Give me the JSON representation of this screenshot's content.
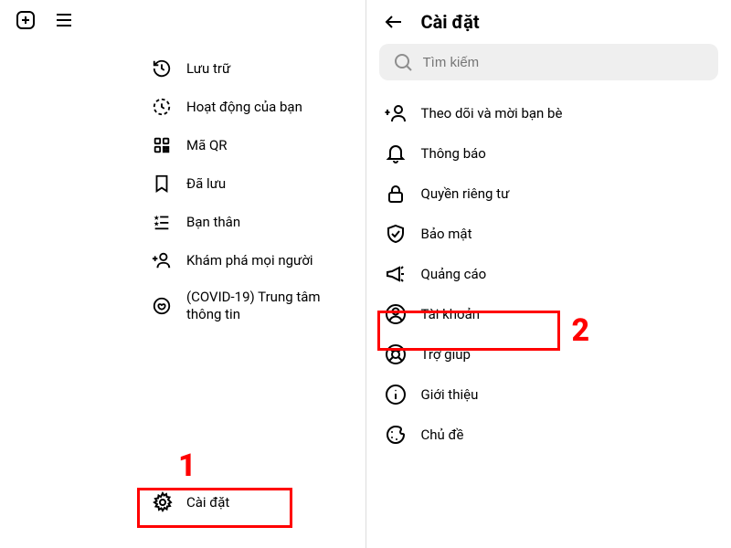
{
  "left": {
    "menu": [
      {
        "icon": "history-icon",
        "label": "Lưu trữ"
      },
      {
        "icon": "activity-icon",
        "label": "Hoạt động của bạn"
      },
      {
        "icon": "qr-icon",
        "label": "Mã QR"
      },
      {
        "icon": "saved-icon",
        "label": "Đã lưu"
      },
      {
        "icon": "close-friends-icon",
        "label": "Bạn thân"
      },
      {
        "icon": "discover-people-icon",
        "label": "Khám phá mọi người"
      },
      {
        "icon": "covid-icon",
        "label": "(COVID-19) Trung tâm thông tin"
      }
    ],
    "settings_label": "Cài đặt"
  },
  "right": {
    "title": "Cài đặt",
    "search_placeholder": "Tìm kiếm",
    "items": [
      {
        "icon": "follow-invite-icon",
        "label": "Theo dõi và mời bạn bè"
      },
      {
        "icon": "bell-icon",
        "label": "Thông báo"
      },
      {
        "icon": "lock-icon",
        "label": "Quyền riêng tư"
      },
      {
        "icon": "shield-icon",
        "label": "Bảo mật"
      },
      {
        "icon": "megaphone-icon",
        "label": "Quảng cáo"
      },
      {
        "icon": "account-icon",
        "label": "Tài khoản"
      },
      {
        "icon": "help-icon",
        "label": "Trợ giúp"
      },
      {
        "icon": "info-icon",
        "label": "Giới thiệu"
      },
      {
        "icon": "theme-icon",
        "label": "Chủ đề"
      }
    ]
  },
  "annotations": {
    "step1": "1",
    "step2": "2"
  }
}
